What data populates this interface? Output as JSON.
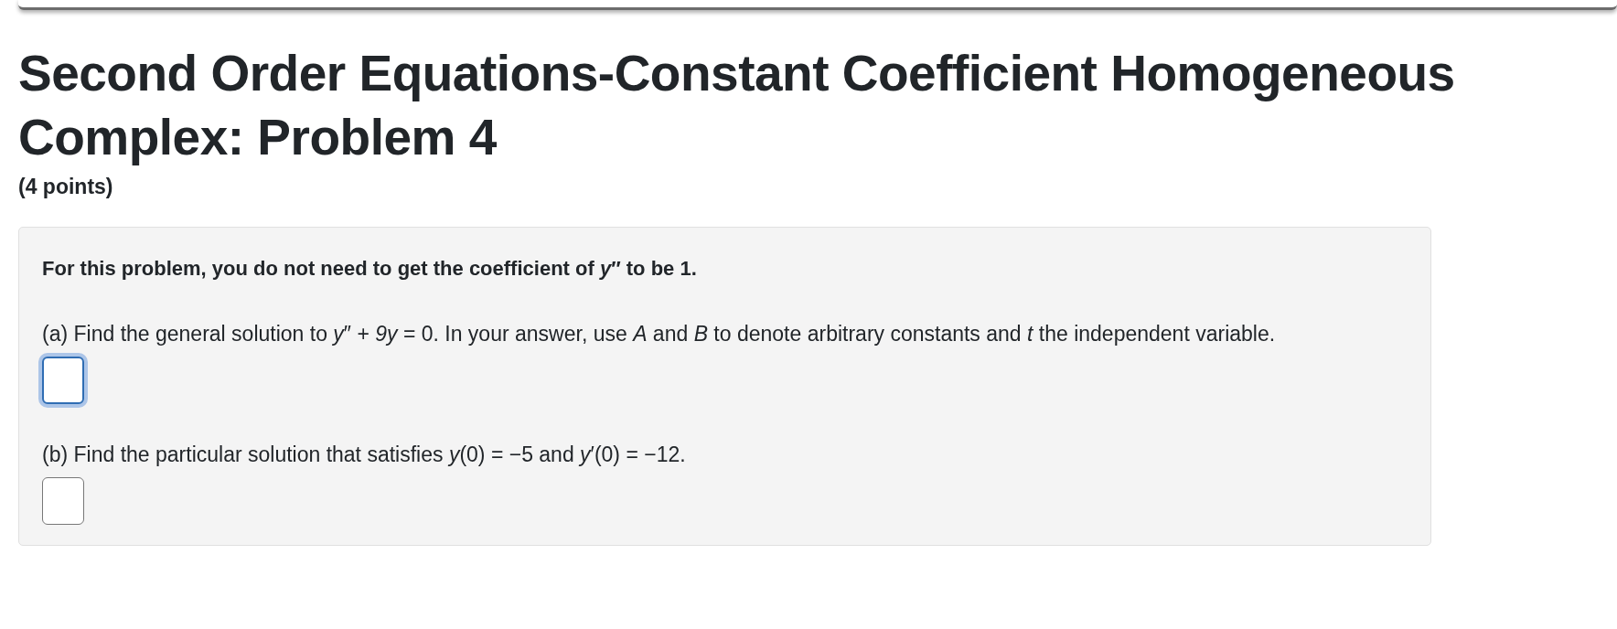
{
  "title": "Second Order Equations-Constant Coefficient Homogeneous Complex: Problem 4",
  "points": "(4 points)",
  "problem": {
    "intro": "For this problem, you do not need to get the coefficient of *y*″ to be 1.",
    "parts": [
      {
        "text": "(a) Find the general solution to *y*″ + *9y* = 0. In your answer, use *A* and *B* to denote arbitrary constants and *t* the independent variable.",
        "answer": {
          "focused": true
        }
      },
      {
        "text": "(b) Find the particular solution that satisfies *y*(0) = −5 and *y*′(0) = −12.",
        "answer": {
          "focused": false
        }
      }
    ]
  }
}
